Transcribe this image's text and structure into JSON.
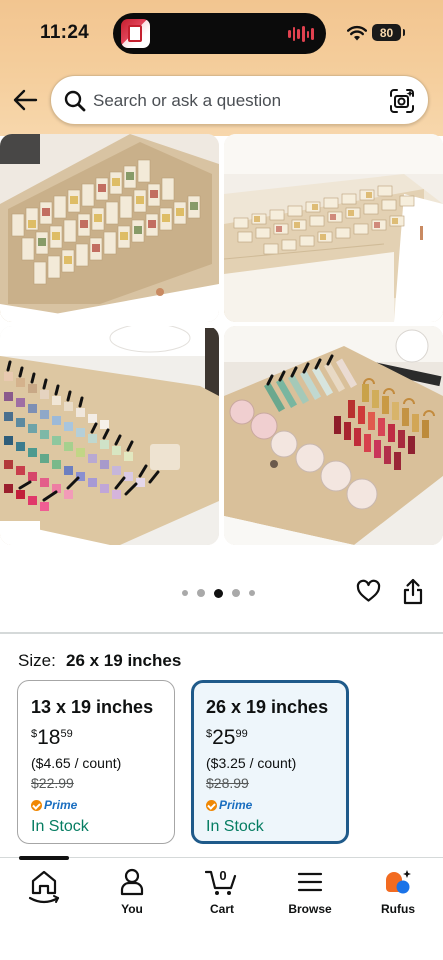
{
  "status_bar": {
    "time": "11:24",
    "battery": "80"
  },
  "search": {
    "placeholder": "Search or ask a question"
  },
  "gallery": {
    "images": [
      {
        "name": "spice-jar-drawer-organizer"
      },
      {
        "name": "spice-drawer-side-view"
      },
      {
        "name": "nail-polish-drawer-organizer"
      },
      {
        "name": "makeup-drawer-organizer"
      }
    ],
    "dots": 5,
    "active_dot": 2
  },
  "size": {
    "label": "Size:",
    "selected": "26 x 19 inches",
    "options": [
      {
        "title": "13 x 19 inches",
        "currency": "$",
        "price_whole": "18",
        "price_fraction": "59",
        "unit_price": "($4.65 / count)",
        "list_price": "$22.99",
        "prime": "Prime",
        "stock": "In Stock",
        "selected": false
      },
      {
        "title": "26 x 19 inches",
        "currency": "$",
        "price_whole": "25",
        "price_fraction": "99",
        "unit_price": "($3.25 / count)",
        "list_price": "$28.99",
        "prime": "Prime",
        "stock": "In Stock",
        "selected": true
      }
    ]
  },
  "bottom_nav": {
    "home_label": "",
    "you_label": "You",
    "cart_label": "Cart",
    "cart_count": "0",
    "browse_label": "Browse",
    "rufus_label": "Rufus"
  },
  "colors": {
    "header_bg": "#f5cf9e",
    "selected_border": "#1f5a8a",
    "selected_bg": "#eef6fb",
    "in_stock": "#067d62",
    "prime_blue": "#1a6ec0",
    "prime_orange": "#f08804"
  }
}
